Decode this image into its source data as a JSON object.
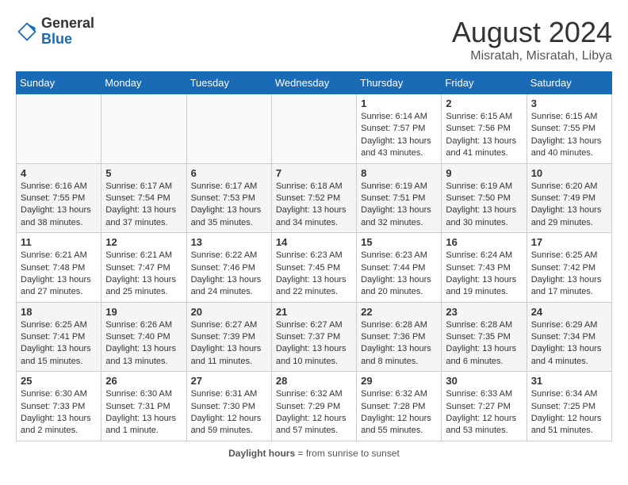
{
  "header": {
    "logo_line1": "General",
    "logo_line2": "Blue",
    "month_year": "August 2024",
    "location": "Misratah, Misratah, Libya"
  },
  "calendar": {
    "days_of_week": [
      "Sunday",
      "Monday",
      "Tuesday",
      "Wednesday",
      "Thursday",
      "Friday",
      "Saturday"
    ],
    "weeks": [
      [
        {
          "day": "",
          "info": ""
        },
        {
          "day": "",
          "info": ""
        },
        {
          "day": "",
          "info": ""
        },
        {
          "day": "",
          "info": ""
        },
        {
          "day": "1",
          "info": "Sunrise: 6:14 AM\nSunset: 7:57 PM\nDaylight: 13 hours\nand 43 minutes."
        },
        {
          "day": "2",
          "info": "Sunrise: 6:15 AM\nSunset: 7:56 PM\nDaylight: 13 hours\nand 41 minutes."
        },
        {
          "day": "3",
          "info": "Sunrise: 6:15 AM\nSunset: 7:55 PM\nDaylight: 13 hours\nand 40 minutes."
        }
      ],
      [
        {
          "day": "4",
          "info": "Sunrise: 6:16 AM\nSunset: 7:55 PM\nDaylight: 13 hours\nand 38 minutes."
        },
        {
          "day": "5",
          "info": "Sunrise: 6:17 AM\nSunset: 7:54 PM\nDaylight: 13 hours\nand 37 minutes."
        },
        {
          "day": "6",
          "info": "Sunrise: 6:17 AM\nSunset: 7:53 PM\nDaylight: 13 hours\nand 35 minutes."
        },
        {
          "day": "7",
          "info": "Sunrise: 6:18 AM\nSunset: 7:52 PM\nDaylight: 13 hours\nand 34 minutes."
        },
        {
          "day": "8",
          "info": "Sunrise: 6:19 AM\nSunset: 7:51 PM\nDaylight: 13 hours\nand 32 minutes."
        },
        {
          "day": "9",
          "info": "Sunrise: 6:19 AM\nSunset: 7:50 PM\nDaylight: 13 hours\nand 30 minutes."
        },
        {
          "day": "10",
          "info": "Sunrise: 6:20 AM\nSunset: 7:49 PM\nDaylight: 13 hours\nand 29 minutes."
        }
      ],
      [
        {
          "day": "11",
          "info": "Sunrise: 6:21 AM\nSunset: 7:48 PM\nDaylight: 13 hours\nand 27 minutes."
        },
        {
          "day": "12",
          "info": "Sunrise: 6:21 AM\nSunset: 7:47 PM\nDaylight: 13 hours\nand 25 minutes."
        },
        {
          "day": "13",
          "info": "Sunrise: 6:22 AM\nSunset: 7:46 PM\nDaylight: 13 hours\nand 24 minutes."
        },
        {
          "day": "14",
          "info": "Sunrise: 6:23 AM\nSunset: 7:45 PM\nDaylight: 13 hours\nand 22 minutes."
        },
        {
          "day": "15",
          "info": "Sunrise: 6:23 AM\nSunset: 7:44 PM\nDaylight: 13 hours\nand 20 minutes."
        },
        {
          "day": "16",
          "info": "Sunrise: 6:24 AM\nSunset: 7:43 PM\nDaylight: 13 hours\nand 19 minutes."
        },
        {
          "day": "17",
          "info": "Sunrise: 6:25 AM\nSunset: 7:42 PM\nDaylight: 13 hours\nand 17 minutes."
        }
      ],
      [
        {
          "day": "18",
          "info": "Sunrise: 6:25 AM\nSunset: 7:41 PM\nDaylight: 13 hours\nand 15 minutes."
        },
        {
          "day": "19",
          "info": "Sunrise: 6:26 AM\nSunset: 7:40 PM\nDaylight: 13 hours\nand 13 minutes."
        },
        {
          "day": "20",
          "info": "Sunrise: 6:27 AM\nSunset: 7:39 PM\nDaylight: 13 hours\nand 11 minutes."
        },
        {
          "day": "21",
          "info": "Sunrise: 6:27 AM\nSunset: 7:37 PM\nDaylight: 13 hours\nand 10 minutes."
        },
        {
          "day": "22",
          "info": "Sunrise: 6:28 AM\nSunset: 7:36 PM\nDaylight: 13 hours\nand 8 minutes."
        },
        {
          "day": "23",
          "info": "Sunrise: 6:28 AM\nSunset: 7:35 PM\nDaylight: 13 hours\nand 6 minutes."
        },
        {
          "day": "24",
          "info": "Sunrise: 6:29 AM\nSunset: 7:34 PM\nDaylight: 13 hours\nand 4 minutes."
        }
      ],
      [
        {
          "day": "25",
          "info": "Sunrise: 6:30 AM\nSunset: 7:33 PM\nDaylight: 13 hours\nand 2 minutes."
        },
        {
          "day": "26",
          "info": "Sunrise: 6:30 AM\nSunset: 7:31 PM\nDaylight: 13 hours\nand 1 minute."
        },
        {
          "day": "27",
          "info": "Sunrise: 6:31 AM\nSunset: 7:30 PM\nDaylight: 12 hours\nand 59 minutes."
        },
        {
          "day": "28",
          "info": "Sunrise: 6:32 AM\nSunset: 7:29 PM\nDaylight: 12 hours\nand 57 minutes."
        },
        {
          "day": "29",
          "info": "Sunrise: 6:32 AM\nSunset: 7:28 PM\nDaylight: 12 hours\nand 55 minutes."
        },
        {
          "day": "30",
          "info": "Sunrise: 6:33 AM\nSunset: 7:27 PM\nDaylight: 12 hours\nand 53 minutes."
        },
        {
          "day": "31",
          "info": "Sunrise: 6:34 AM\nSunset: 7:25 PM\nDaylight: 12 hours\nand 51 minutes."
        }
      ]
    ]
  },
  "footer": {
    "note": "Daylight hours"
  }
}
